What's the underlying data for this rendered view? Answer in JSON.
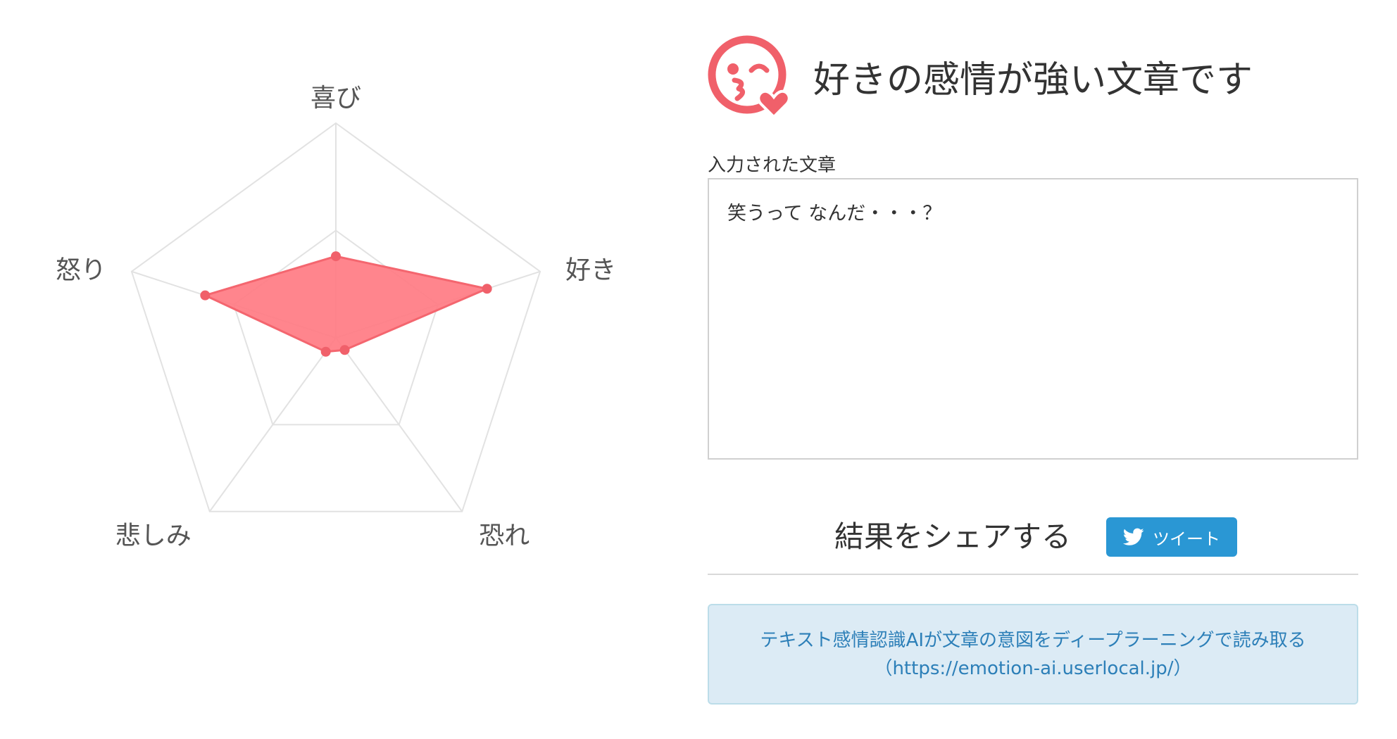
{
  "chart_data": {
    "type": "radar",
    "axes": [
      "喜び",
      "好き",
      "恐れ",
      "悲しみ",
      "怒り"
    ],
    "max": 1.0,
    "series": [
      {
        "values": [
          0.38,
          0.74,
          0.07,
          0.08,
          0.64
        ]
      }
    ],
    "colors": {
      "fill": "#ff7b83",
      "stroke": "#f4666f",
      "point": "#f0606a",
      "grid": "#e2e2e2",
      "label": "#555555"
    }
  },
  "result": {
    "icon": "kissing-face-heart-icon",
    "icon_color": "#f0606a",
    "title": "好きの感情が強い文章です"
  },
  "input": {
    "label": "入力された文章",
    "value": "笑うって なんだ・・・？"
  },
  "share": {
    "label": "結果をシェアする",
    "tweet_label": "ツイート",
    "tweet_icon": "twitter-bird-icon",
    "tweet_color": "#2a97d4"
  },
  "info": {
    "line1": "テキスト感情認識AIが文章の意図をディープラーニングで読み取る",
    "line2": "（https://emotion-ai.userlocal.jp/）"
  }
}
